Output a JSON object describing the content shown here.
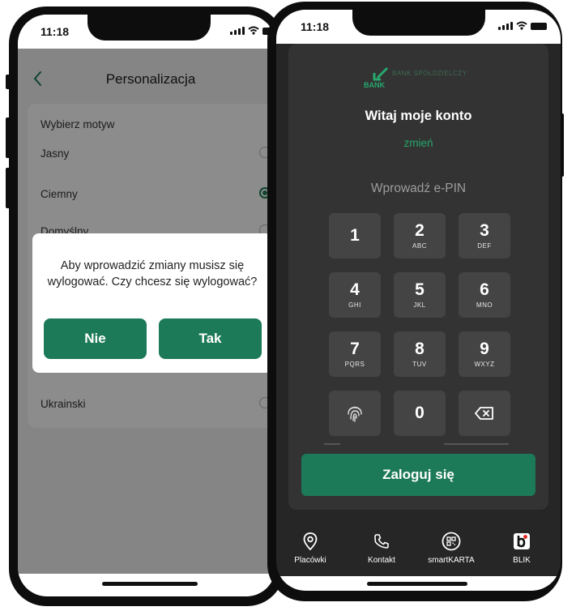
{
  "left_phone": {
    "time": "11:18",
    "title": "Personalizacja",
    "section_title": "Wybierz motyw",
    "options": [
      {
        "label": "Jasny",
        "selected": false
      },
      {
        "label": "Ciemny",
        "selected": true
      },
      {
        "label": "Domyślny",
        "selected": false
      }
    ],
    "language_option": "Ukrainski",
    "dialog": {
      "message": "Aby wprowadzić zmiany musisz się wylogować. Czy chcesz się wylogować?",
      "no_label": "Nie",
      "yes_label": "Tak"
    }
  },
  "right_phone": {
    "time": "11:18",
    "logo_text": "BANK SPÓŁDZIELCZY",
    "logo_brand": "BANK",
    "welcome": "Witaj moje konto",
    "change_link": "zmień",
    "epin_label": "Wprowadź e-PIN",
    "keys": [
      {
        "digit": "1",
        "letters": ""
      },
      {
        "digit": "2",
        "letters": "ABC"
      },
      {
        "digit": "3",
        "letters": "DEF"
      },
      {
        "digit": "4",
        "letters": "GHI"
      },
      {
        "digit": "5",
        "letters": "JKL"
      },
      {
        "digit": "6",
        "letters": "MNO"
      },
      {
        "digit": "7",
        "letters": "PQRS"
      },
      {
        "digit": "8",
        "letters": "TUV"
      },
      {
        "digit": "9",
        "letters": "WXYZ"
      },
      {
        "digit": "0",
        "letters": ""
      }
    ],
    "login_label": "Zaloguj się",
    "nav": [
      {
        "label": "Placówki",
        "icon": "location-pin-icon"
      },
      {
        "label": "Kontakt",
        "icon": "phone-icon"
      },
      {
        "label": "smartKARTA",
        "icon": "qr-code-icon"
      },
      {
        "label": "BLIK",
        "icon": "blik-icon"
      }
    ]
  },
  "colors": {
    "accent_green": "#1c7a58",
    "link_green": "#26a86d",
    "dark_bg": "#262626",
    "key_bg": "#444444"
  }
}
